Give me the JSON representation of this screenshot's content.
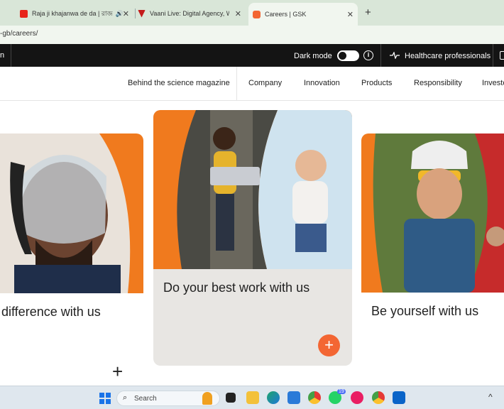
{
  "browser": {
    "tabs": [
      {
        "title": "Raja ji khajanwa de da | রাজ",
        "color": "#e8241a"
      },
      {
        "title": "Vaani Live: Digital Agency, Web",
        "color": "#c41b1b"
      },
      {
        "title": "Careers | GSK",
        "color": "#f36633"
      }
    ],
    "new_tab": "+",
    "url": "-gb/careers/"
  },
  "topbar": {
    "left_partial": "n",
    "dark_mode_label": "Dark mode",
    "info": "i",
    "healthcare_label": "Healthcare professionals"
  },
  "nav": {
    "items": [
      "Behind the science magazine",
      "Company",
      "Innovation",
      "Products",
      "Responsibility",
      "Investo"
    ]
  },
  "cards": {
    "left_text": "difference with us",
    "center_text": "Do your best work with us",
    "right_text": "Be yourself with us",
    "plus": "+"
  },
  "taskbar": {
    "search_placeholder": "Search",
    "whatsapp_badge": "19",
    "chevron": "^",
    "accent": "#f36633"
  }
}
